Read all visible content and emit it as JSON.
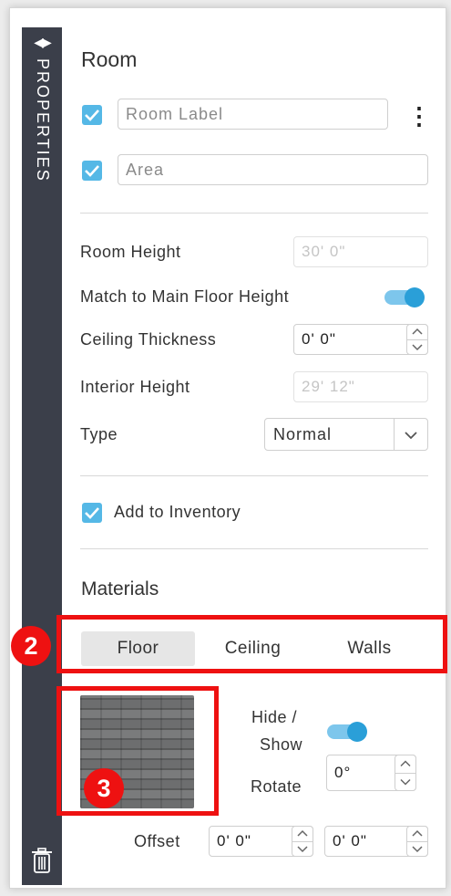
{
  "rail": {
    "title": "PROPERTIES",
    "arrows_icon": "collapse-expand-arrows-icon",
    "delete_icon": "trash-icon"
  },
  "room": {
    "title": "Room",
    "room_label_placeholder": "Room Label",
    "area_placeholder": "Area",
    "room_label_checked": true,
    "area_checked": true,
    "menu_icon": "vertical-ellipsis-icon"
  },
  "fields": {
    "room_height_label": "Room Height",
    "room_height_value": "30'    0\"",
    "match_label": "Match to Main Floor Height",
    "match_on": true,
    "ceiling_thickness_label": "Ceiling Thickness",
    "ceiling_thickness_value": "0'     0\"",
    "interior_height_label": "Interior Height",
    "interior_height_value": "29'    12\"",
    "type_label": "Type",
    "type_value": "Normal"
  },
  "inventory": {
    "label": "Add to Inventory",
    "checked": true
  },
  "materials": {
    "title": "Materials",
    "tabs": [
      "Floor",
      "Ceiling",
      "Walls"
    ],
    "active_tab": "Floor",
    "hide_show_line1": "Hide /",
    "hide_show_line2": "Show",
    "hide_show_on": true,
    "rotate_label": "Rotate",
    "rotate_value": "0°",
    "offset_label": "Offset",
    "offset_x": "0'  0\"",
    "offset_y": "0'  0\""
  },
  "annotations": {
    "badge_tabs": "2",
    "badge_swatch": "3"
  },
  "colors": {
    "accent": "#55b8e6",
    "rail": "#3b3f4a",
    "highlight": "#ee1111"
  }
}
